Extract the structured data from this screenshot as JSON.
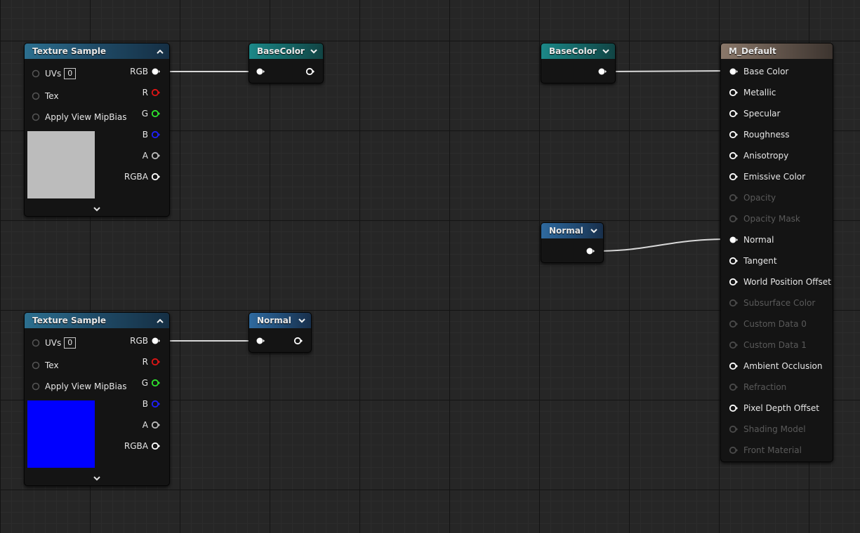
{
  "colors": {
    "preview_top": "#bcbcbc",
    "preview_bottom": "#0000ff",
    "pin_r": "#e01515",
    "pin_g": "#2ee52e",
    "pin_b": "#2020ff",
    "pin_white": "#ffffff"
  },
  "texture_sample_1": {
    "title": "Texture Sample",
    "inputs": [
      "UVs",
      "Tex",
      "Apply View MipBias"
    ],
    "uv_value": "0",
    "outputs": [
      "RGB",
      "R",
      "G",
      "B",
      "A",
      "RGBA"
    ]
  },
  "texture_sample_2": {
    "title": "Texture Sample",
    "inputs": [
      "UVs",
      "Tex",
      "Apply View MipBias"
    ],
    "uv_value": "0",
    "outputs": [
      "RGB",
      "R",
      "G",
      "B",
      "A",
      "RGBA"
    ]
  },
  "reroute_basecolor_in": {
    "title": "BaseColor"
  },
  "reroute_basecolor_out": {
    "title": "BaseColor"
  },
  "reroute_normal_in": {
    "title": "Normal"
  },
  "reroute_normal_out": {
    "title": "Normal"
  },
  "material": {
    "title": "M_Default",
    "pins": [
      {
        "label": "Base Color",
        "active": true,
        "connected": true
      },
      {
        "label": "Metallic",
        "active": true,
        "connected": false
      },
      {
        "label": "Specular",
        "active": true,
        "connected": false
      },
      {
        "label": "Roughness",
        "active": true,
        "connected": false
      },
      {
        "label": "Anisotropy",
        "active": true,
        "connected": false
      },
      {
        "label": "Emissive Color",
        "active": true,
        "connected": false
      },
      {
        "label": "Opacity",
        "active": false,
        "connected": false
      },
      {
        "label": "Opacity Mask",
        "active": false,
        "connected": false
      },
      {
        "label": "Normal",
        "active": true,
        "connected": true
      },
      {
        "label": "Tangent",
        "active": true,
        "connected": false
      },
      {
        "label": "World Position Offset",
        "active": true,
        "connected": false
      },
      {
        "label": "Subsurface Color",
        "active": false,
        "connected": false
      },
      {
        "label": "Custom Data 0",
        "active": false,
        "connected": false
      },
      {
        "label": "Custom Data 1",
        "active": false,
        "connected": false
      },
      {
        "label": "Ambient Occlusion",
        "active": true,
        "connected": false
      },
      {
        "label": "Refraction",
        "active": false,
        "connected": false
      },
      {
        "label": "Pixel Depth Offset",
        "active": true,
        "connected": false
      },
      {
        "label": "Shading Model",
        "active": false,
        "connected": false
      },
      {
        "label": "Front Material",
        "active": false,
        "connected": false
      }
    ]
  }
}
